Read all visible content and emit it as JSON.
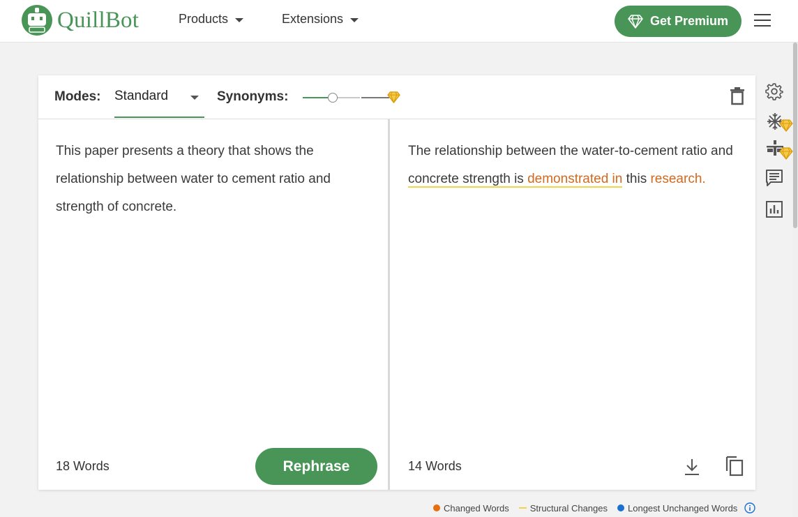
{
  "header": {
    "brand": "QuillBot",
    "nav": [
      {
        "label": "Products"
      },
      {
        "label": "Extensions"
      }
    ],
    "premium_label": "Get Premium"
  },
  "toolbar": {
    "modes_label": "Modes:",
    "mode_value": "Standard",
    "synonyms_label": "Synonyms:",
    "synonyms_level": 0.33
  },
  "input": {
    "text": "This paper presents a theory that shows the relationship between water to cement ratio and strength of concrete.",
    "word_count": "18 Words",
    "rephrase_label": "Rephrase"
  },
  "output": {
    "segments": [
      {
        "text": "The relationship between the water-to-cement ratio and "
      },
      {
        "text": "concrete strength is ",
        "type": "structural"
      },
      {
        "text": "demonstrated in",
        "type": "changed structural"
      },
      {
        "text": " this "
      },
      {
        "text": "research.",
        "type": "changed"
      }
    ],
    "word_count": "14 Words"
  },
  "legend": {
    "changed": "Changed Words",
    "structural": "Structural Changes",
    "unchanged": "Longest Unchanged Words"
  },
  "colors": {
    "brand_green": "#499557",
    "changed": "#d2691e",
    "structural": "#f0d54a",
    "unchanged": "#1a6fd1",
    "premium_gem": "#f2b51b"
  },
  "icons": {
    "settings": "gear-icon",
    "freeze": "snowflake-icon",
    "compare": "compare-icon",
    "comments": "comment-icon",
    "stats": "bar-chart-icon",
    "delete": "trash-icon",
    "download": "download-icon",
    "copy": "copy-icon"
  }
}
